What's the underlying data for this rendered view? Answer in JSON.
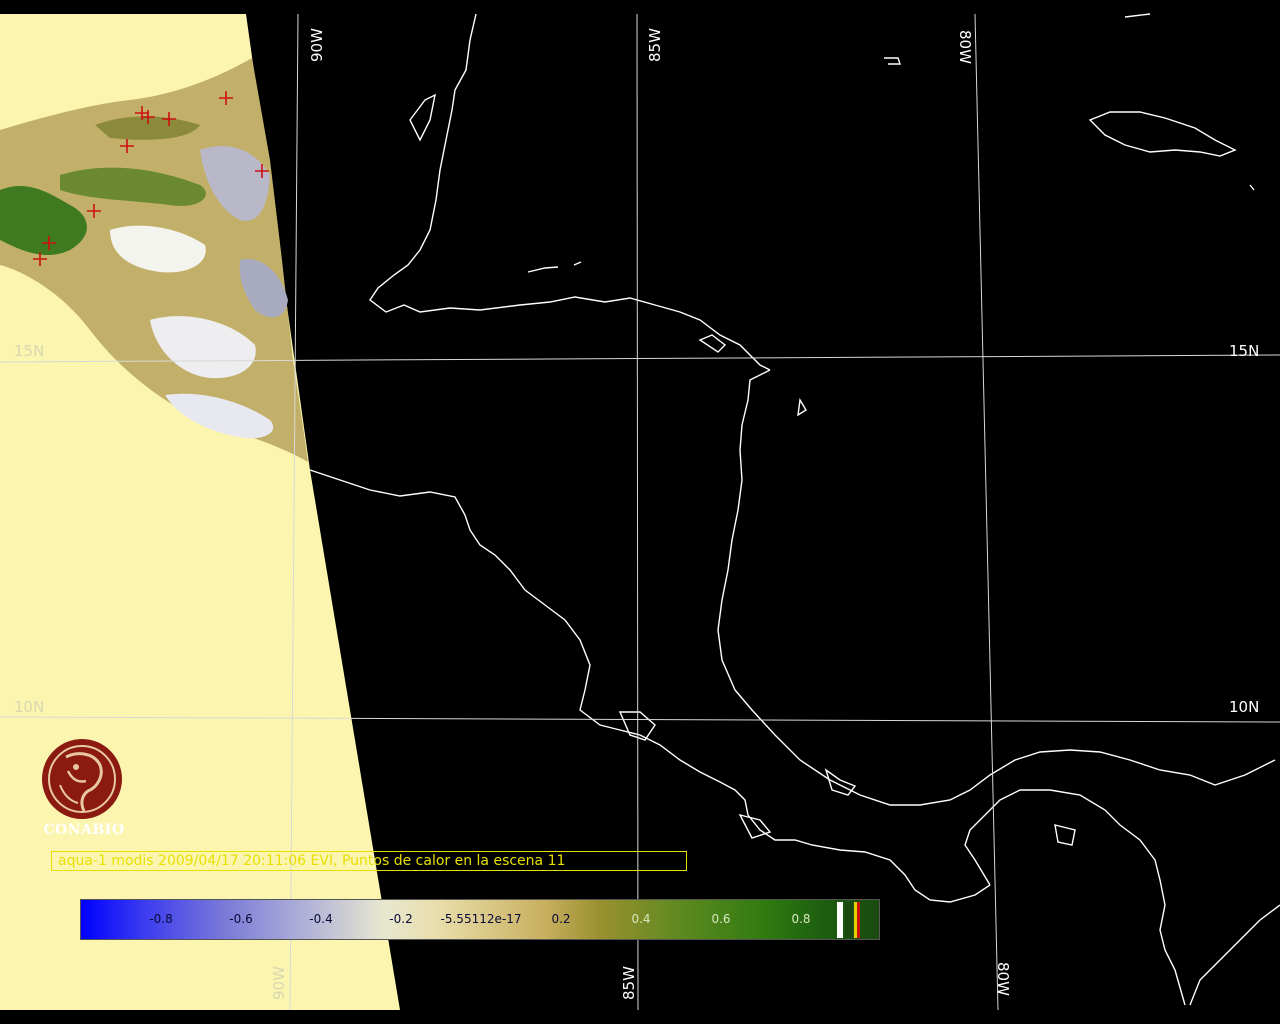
{
  "map": {
    "graticule_labels": {
      "lon_top": [
        "90W",
        "85W",
        "80W"
      ],
      "lon_bottom": [
        "90W",
        "85W",
        "80W"
      ],
      "lat_left": [
        "15N",
        "10N"
      ],
      "lat_right": [
        "15N",
        "10N"
      ]
    },
    "hotspot_count_label": "11",
    "caption": "aqua-1 modis 2009/04/17 20:11:06 EVI, Puntos de calor en la escena 11",
    "hotspot_marker_color": "#cc1010"
  },
  "colorbar": {
    "tick_labels": [
      "-0.8",
      "-0.6",
      "-0.4",
      "-0.2",
      "-5.55112e-17",
      "0.2",
      "0.4",
      "0.6",
      "0.8"
    ],
    "colors": {
      "low": "#0000ff",
      "mid": "#e8e8d0",
      "high": "#1a4a10"
    }
  },
  "logo": {
    "name": "CONABIO",
    "color": "#8b1a10"
  }
}
